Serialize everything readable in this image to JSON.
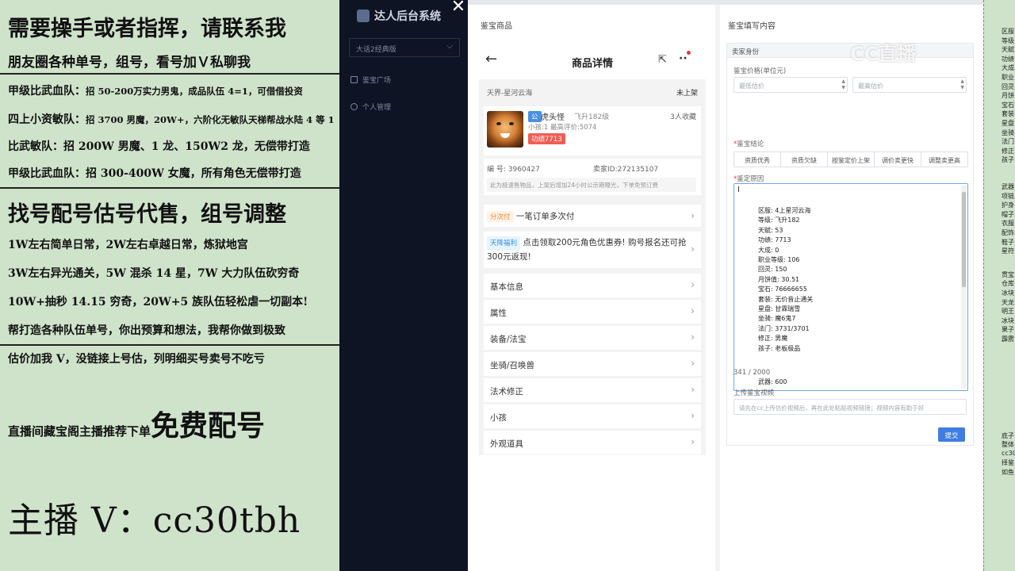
{
  "promo": {
    "line1": "需要操手或者指挥，请联系我",
    "line2": "朋友圈各种单号，组号，看号加Ｖ私聊我",
    "line3a": "甲级比武血队：",
    "line3b": "招 50-200万实力男鬼，成品队伍 4=1，可借借投资",
    "line4a": "四上小资敏队：",
    "line4b": "招 3700 男魔，20W+，六阶化无敏队天梯帮战水陆 4 等 1",
    "line5": "比武敏队：招 200W 男魔、1 龙、150W2 龙，无偿带打造",
    "line6": "甲级比武血队：招 300-400W 女魔，所有角色无偿带打造",
    "line7": "找号配号估号代售，组号调整",
    "line8": "1W左右简单日常，2W左右卓越日常，炼狱地宫",
    "line9": "3W左右异光通关，5W 混杀 14 星，7W 大力队伍砍穷奇",
    "line10": "10W+抽秒 14.15 穷奇，20W+5 族队伍轻松虐一切副本!",
    "line11": "帮打造各种队伍单号，你出预算和想法，我帮你做到极致",
    "line12": "估价加我 V，没链接上号估，列明细买号卖号不吃亏",
    "line13a": "直播间藏宝阁主播推荐下单",
    "line13b": "免费配号",
    "line14": "主播 V：cc30tbh"
  },
  "sidebar": {
    "brand": "达人后台系统",
    "close": "✕",
    "select_value": "大话2经典版",
    "nav": [
      "鉴宝广场",
      "个人管理"
    ]
  },
  "left_panel": {
    "title": "鉴宝商品",
    "header_title": "商品详情",
    "server": "天界-星河云海",
    "status": "未上架",
    "role_badge": "公",
    "role_name": "虎头怪",
    "role_level": "飞升182级",
    "favorites": "3人收藏",
    "small_info": "小孩:1 最高评价:5074",
    "power_tag": "功绩7713",
    "id_label": "编 号: 3960427",
    "seller_label": "卖家ID:272135107",
    "notice": "此为极速售物品，上架后增加24小时公示期曝光，下单免预订费",
    "pay_tag": "分次付",
    "pay_text": "一笔订单多次付",
    "promo_tag": "天降福利",
    "promo_text": "点击领取200元角色优惠券! 购号报名还可抢300元返现!",
    "rows": [
      "基本信息",
      "属性",
      "装备/法宝",
      "坐骑/召唤兽",
      "法术修正",
      "小孩",
      "外观道具"
    ]
  },
  "right_panel": {
    "title": "鉴宝填写内容",
    "section_head": "卖家身份",
    "price_label": "鉴宝价格(单位元)",
    "min_price_ph": "最低估价",
    "max_price_ph": "最高估价",
    "conclusion_label": "鉴宝结论",
    "conclusion_options": [
      "资质优秀",
      "资质欠缺",
      "按鉴定价上架",
      "调价卖更快",
      "调整卖更高"
    ],
    "reason_label": "鉴定原因",
    "reason_lines": [
      "区服:      4上星河云海",
      "等级:      飞升182",
      "天赋:      53",
      "功绩:      7713",
      "大成:      0",
      "职业等级:      106",
      "回灵:      150",
      "月饼值:      30.51",
      "宝石:      76666655",
      "套装:      无价音止通关",
      "星盘:      甘霖瑞雪",
      "坐骑:      魔6鬼7",
      "法门:      3731/3701",
      "修正:      男魔",
      "孩子:      老板极品",
      "武器:      600"
    ],
    "char_count": "341 / 2000",
    "video_label": "上传鉴宝视频",
    "video_ph": "请先在cc上传估价视频后，再在此处粘贴视频链接；视频内容有助于好",
    "submit": "提交"
  },
  "strip": {
    "items": [
      "区服",
      "等级",
      "天赋",
      "功绩",
      "大成",
      "职业",
      "回灵",
      "月饼",
      "宝石",
      "套装",
      "星盘",
      "坐骑",
      "法门",
      "修正",
      "孩子",
      "武器",
      "项链",
      "护身",
      "帽子",
      "衣服",
      "配饰",
      "鞋子",
      "星符",
      "贯宝",
      "仓库",
      "冰块",
      "天龙",
      "明王",
      "冰块",
      "果子",
      "霹雳",
      "底子",
      "整体",
      "cc30",
      "择鉴",
      "如鱼"
    ]
  },
  "watermark": "CC直播",
  "colors": {
    "accent": "#3f7de0",
    "sidebar": "#0f1424",
    "promo_bg": "#cfe3cb",
    "power_tag": "#f25c54"
  }
}
